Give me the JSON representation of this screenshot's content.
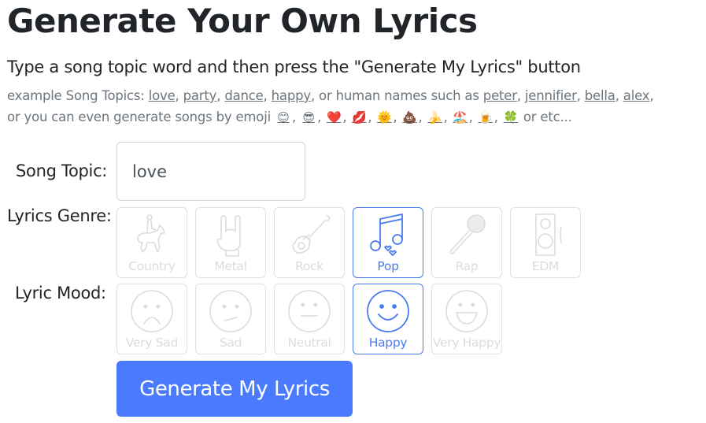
{
  "page": {
    "title": "Generate Your Own Lyrics",
    "instructions": "Type a song topic word and then press the \"Generate My Lyrics\" button"
  },
  "examples": {
    "prefix": "example Song Topics: ",
    "topics": [
      "love",
      "party",
      "dance",
      "happy"
    ],
    "names_intro": ", or human names such as ",
    "names": [
      "peter",
      "jennifier",
      "bella",
      "alex"
    ],
    "emoji_intro": "or you can even generate songs by emoji ",
    "emojis": [
      "😊",
      "😎",
      "❤️",
      "💋",
      "🌞",
      "💩",
      "🍌",
      "🏖️",
      "🍺",
      "🍀"
    ],
    "suffix": " or etc..."
  },
  "form": {
    "topic_label": "Song Topic:",
    "topic_value": "love",
    "genre_label": "Lyrics Genre:",
    "mood_label": "Lyric Mood:",
    "genres": [
      {
        "label": "Country",
        "icon": "horse-rider-icon",
        "selected": false
      },
      {
        "label": "Metal",
        "icon": "rock-hand-icon",
        "selected": false
      },
      {
        "label": "Rock",
        "icon": "electric-guitar-icon",
        "selected": false
      },
      {
        "label": "Pop",
        "icon": "music-notes-hearts-icon",
        "selected": true
      },
      {
        "label": "Rap",
        "icon": "microphone-icon",
        "selected": false
      },
      {
        "label": "EDM",
        "icon": "speaker-icon",
        "selected": false
      }
    ],
    "moods": [
      {
        "label": "Very Sad",
        "icon": "very-sad-face-icon",
        "selected": false
      },
      {
        "label": "Sad",
        "icon": "sad-face-icon",
        "selected": false
      },
      {
        "label": "Neutral",
        "icon": "neutral-face-icon",
        "selected": false
      },
      {
        "label": "Happy",
        "icon": "happy-face-icon",
        "selected": true
      },
      {
        "label": "Very Happy",
        "icon": "very-happy-face-icon",
        "selected": false
      }
    ],
    "submit_label": "Generate My Lyrics"
  },
  "colors": {
    "accent": "#4a7bff",
    "selected_border": "#4a7bf0",
    "inactive": "#dcdcdc",
    "muted_text": "#6c757d"
  }
}
